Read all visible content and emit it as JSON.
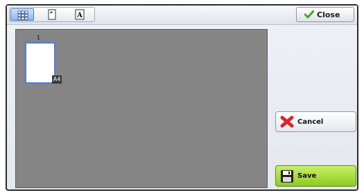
{
  "view_modes": [
    {
      "icon": "grid-view-icon",
      "selected": true
    },
    {
      "icon": "page-view-icon",
      "selected": false
    },
    {
      "icon": "text-view-icon",
      "selected": false
    }
  ],
  "toolbar": {
    "close_label": "Close",
    "close_icon": "checkmark-icon"
  },
  "preview": {
    "page_number": "1",
    "paper_size": "A4"
  },
  "actions": {
    "cancel_label": "Cancel",
    "cancel_icon": "red-x-icon",
    "save_label": "Save",
    "save_icon": "floppy-disk-icon"
  },
  "colors": {
    "selected_tab": "#8db7ec",
    "save_button": "#8dcb1f",
    "cancel_icon": "#d8262a",
    "check_icon": "#4aa51c",
    "preview_background": "#858585"
  }
}
